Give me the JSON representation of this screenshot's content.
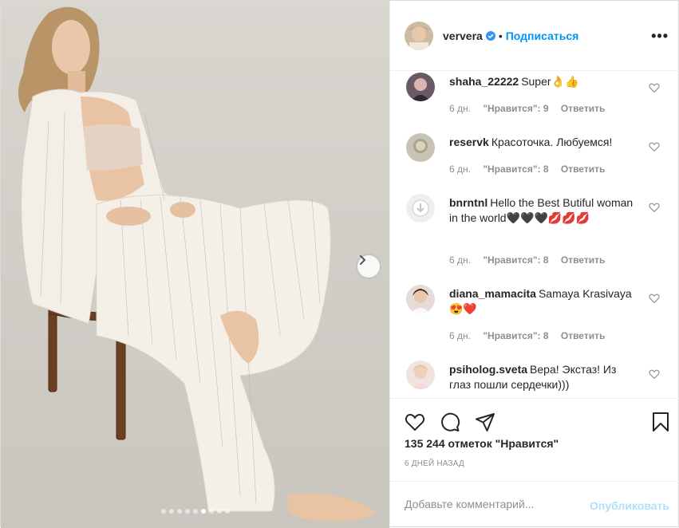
{
  "post": {
    "author": "ververa",
    "separator": "•",
    "follow_label": "Подписаться",
    "more_label": "•••",
    "photo": {
      "slide_count": 9,
      "active_slide": 5
    },
    "likes_text": "135 244 отметок \"Нравится\"",
    "date_text": "6 ДНЕЙ НАЗАД"
  },
  "comments": [
    {
      "username": "shaha_22222",
      "text": "Super👌👍",
      "age": "6 дн.",
      "likes": "\"Нравится\": 9",
      "reply": "Ответить"
    },
    {
      "username": "reservk",
      "text": "Красоточка. Любуемся!",
      "age": "6 дн.",
      "likes": "\"Нравится\": 8",
      "reply": "Ответить"
    },
    {
      "username": "bnrntnl",
      "text": "Hello the Best Butiful woman in the world🖤🖤🖤💋💋💋",
      "age": "6 дн.",
      "likes": "\"Нравится\": 8",
      "reply": "Ответить"
    },
    {
      "username": "diana_mamacita",
      "text": "Samaya Krasivaya 😍❤️",
      "age": "6 дн.",
      "likes": "\"Нравится\": 8",
      "reply": "Ответить"
    },
    {
      "username": "psiholog.sveta",
      "text": "Вера! Экстаз! Из глаз пошли сердечки)))",
      "age": "",
      "likes": "",
      "reply": ""
    }
  ],
  "comment_box": {
    "placeholder": "Добавьте комментарий...",
    "publish_label": "Опубликовать"
  },
  "colors": {
    "accent": "#0095f6",
    "publish_disabled": "#b2dffc",
    "muted": "#8e8e8e"
  }
}
